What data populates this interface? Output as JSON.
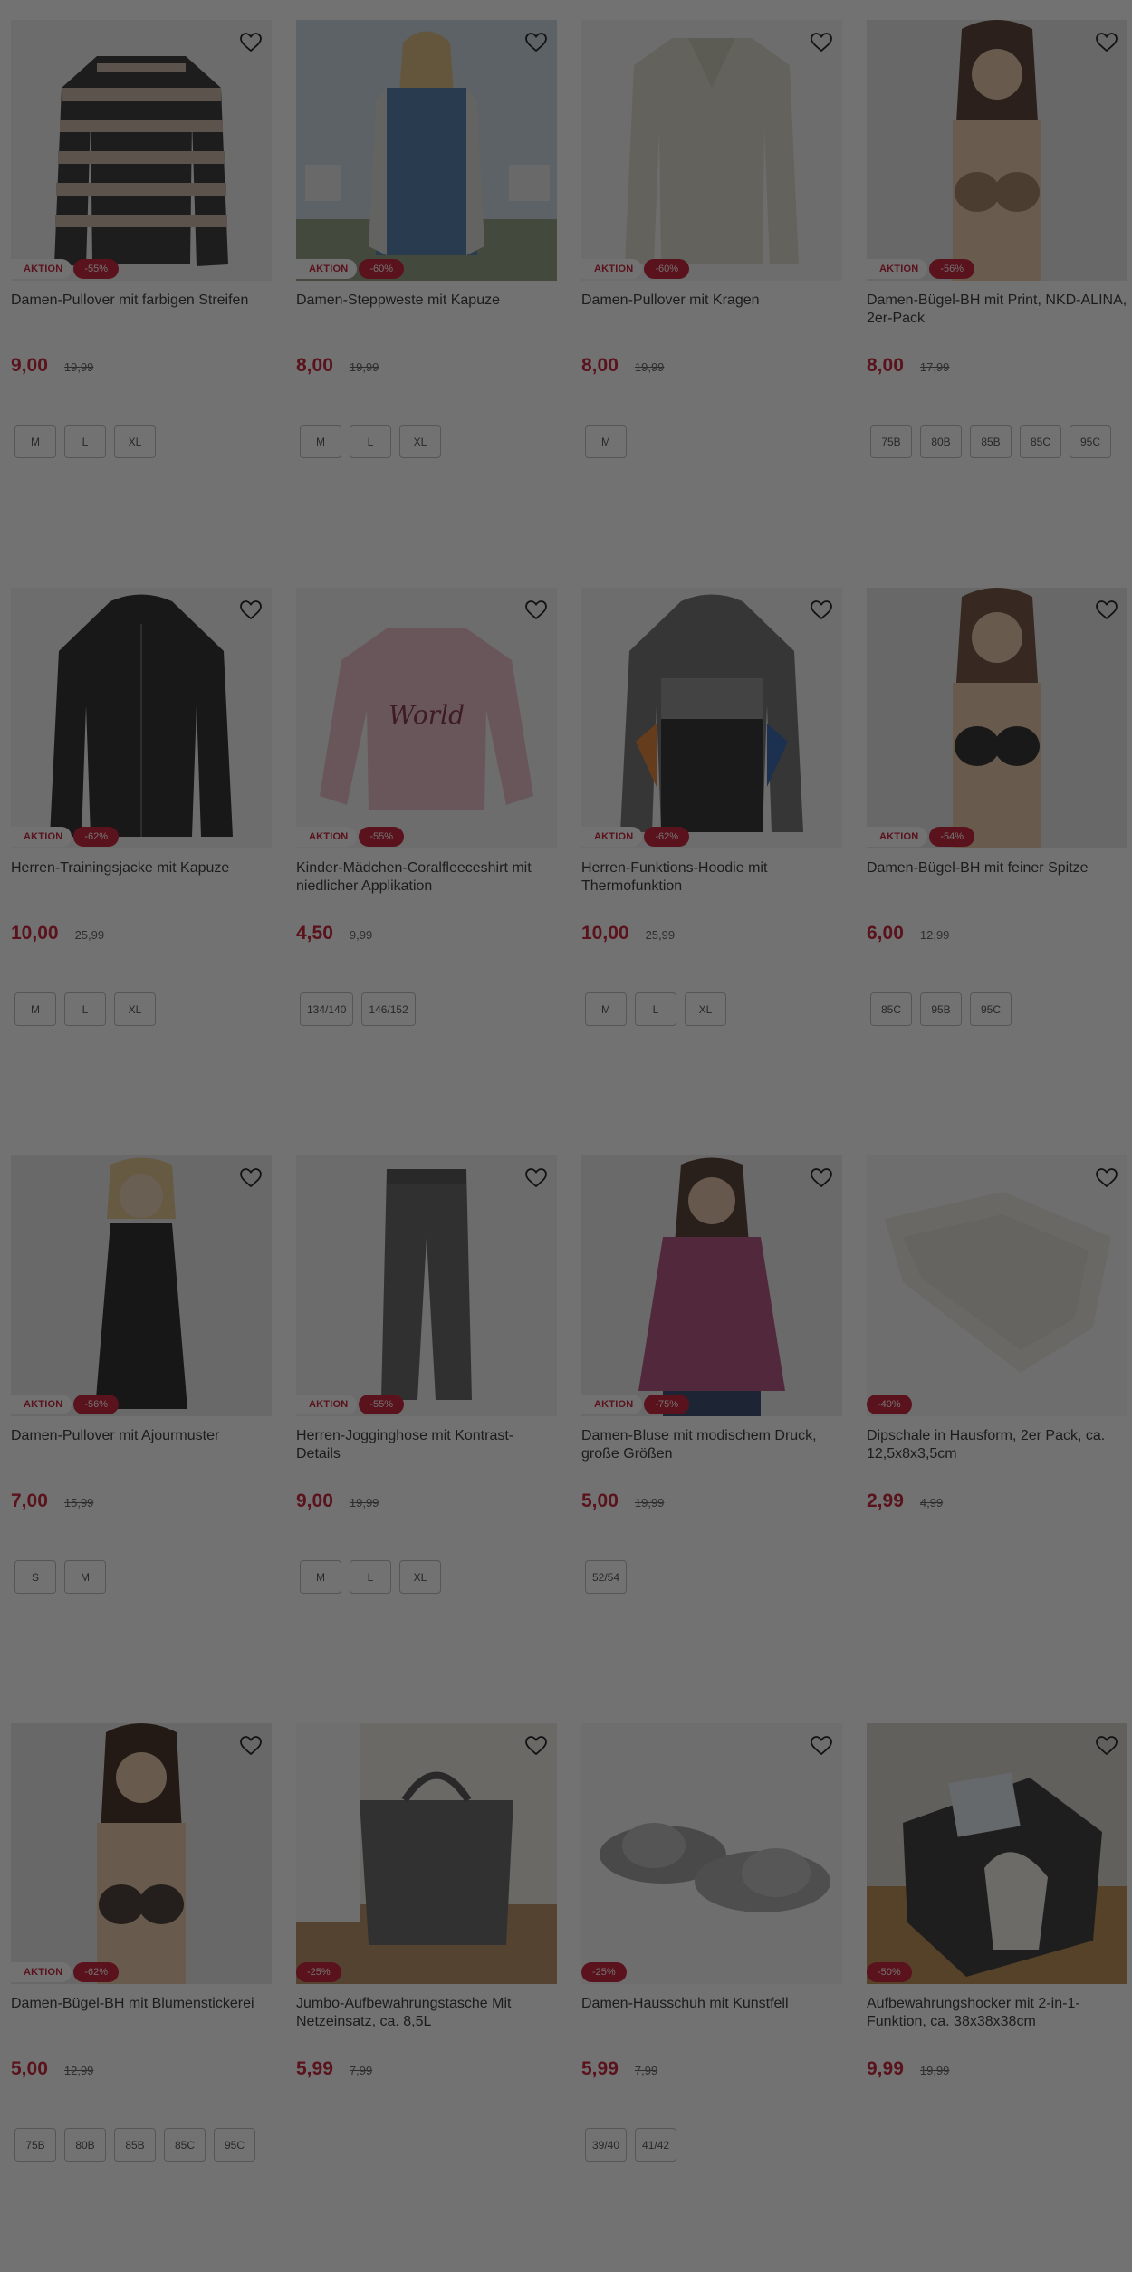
{
  "labels": {
    "aktion": "AKTION"
  },
  "colors": {
    "accent": "#c3112a",
    "overlay": "rgba(20,20,20,0.60)"
  },
  "products": [
    {
      "title": "Damen-Pullover mit farbigen Streifen",
      "price": "9,00",
      "old": "19,99",
      "aktion": true,
      "discount": "-55%",
      "sizes": [
        "M",
        "L",
        "XL"
      ],
      "image": "striped-sweater"
    },
    {
      "title": "Damen-Steppweste mit Kapuze",
      "price": "8,00",
      "old": "19,99",
      "aktion": true,
      "discount": "-60%",
      "sizes": [
        "M",
        "L",
        "XL"
      ],
      "image": "woman-blue-vest"
    },
    {
      "title": "Damen-Pullover mit Kragen",
      "price": "8,00",
      "old": "19,99",
      "aktion": true,
      "discount": "-60%",
      "sizes": [
        "M"
      ],
      "image": "beige-collar-sweater"
    },
    {
      "title": "Damen-Bügel-BH mit Print, NKD-ALINA, 2er-Pack",
      "price": "8,00",
      "old": "17,99",
      "aktion": true,
      "discount": "-56%",
      "sizes": [
        "75B",
        "80B",
        "85B",
        "85C",
        "95C"
      ],
      "image": "woman-print-bra"
    },
    {
      "title": "Herren-Trainingsjacke mit Kapuze",
      "price": "10,00",
      "old": "25,99",
      "aktion": true,
      "discount": "-62%",
      "sizes": [
        "M",
        "L",
        "XL"
      ],
      "image": "black-hooded-jacket"
    },
    {
      "title": "Kinder-Mädchen-Coralfleeceshirt mit niedlicher Applikation",
      "price": "4,50",
      "old": "9,99",
      "aktion": true,
      "discount": "-55%",
      "sizes": [
        "134/140",
        "146/152"
      ],
      "image": "pink-world-sweatshirt"
    },
    {
      "title": "Herren-Funktions-Hoodie mit Thermofunktion",
      "price": "10,00",
      "old": "25,99",
      "aktion": true,
      "discount": "-62%",
      "sizes": [
        "M",
        "L",
        "XL"
      ],
      "image": "grey-black-hoodie"
    },
    {
      "title": "Damen-Bügel-BH mit feiner Spitze",
      "price": "6,00",
      "old": "12,99",
      "aktion": true,
      "discount": "-54%",
      "sizes": [
        "85C",
        "95B",
        "95C"
      ],
      "image": "woman-black-bra"
    },
    {
      "title": "Damen-Pullover mit Ajourmuster",
      "price": "7,00",
      "old": "15,99",
      "aktion": true,
      "discount": "-56%",
      "sizes": [
        "S",
        "M"
      ],
      "image": "woman-black-turtleneck"
    },
    {
      "title": "Herren-Jogginghose mit Kontrast-Details",
      "price": "9,00",
      "old": "19,99",
      "aktion": true,
      "discount": "-55%",
      "sizes": [
        "M",
        "L",
        "XL"
      ],
      "image": "grey-jogging-pants"
    },
    {
      "title": "Damen-Bluse mit modischem Druck, große Größen",
      "price": "5,00",
      "old": "19,99",
      "aktion": true,
      "discount": "-75%",
      "sizes": [
        "52/54"
      ],
      "image": "woman-floral-blouse"
    },
    {
      "title": "Dipschale in Hausform, 2er Pack, ca. 12,5x8x3,5cm",
      "price": "2,99",
      "old": "4,99",
      "aktion": false,
      "discount": "-40%",
      "sizes": [],
      "image": "white-dip-bowl"
    },
    {
      "title": "Damen-Bügel-BH mit Blumenstickerei",
      "price": "5,00",
      "old": "12,99",
      "aktion": true,
      "discount": "-62%",
      "sizes": [
        "75B",
        "80B",
        "85B",
        "85C",
        "95C"
      ],
      "image": "woman-floral-bra"
    },
    {
      "title": "Jumbo-Aufbewahrungstasche Mit Netzeinsatz, ca. 8,5L",
      "price": "5,99",
      "old": "7,99",
      "aktion": false,
      "discount": "-25%",
      "sizes": [],
      "image": "storage-bag"
    },
    {
      "title": "Damen-Hausschuh mit Kunstfell",
      "price": "5,99",
      "old": "7,99",
      "aktion": false,
      "discount": "-25%",
      "sizes": [
        "39/40",
        "41/42"
      ],
      "image": "grey-fur-slippers"
    },
    {
      "title": "Aufbewahrungshocker mit 2-in-1-Funktion, ca. 38x38x38cm",
      "price": "9,99",
      "old": "19,99",
      "aktion": false,
      "discount": "-50%",
      "sizes": [],
      "image": "storage-stool"
    }
  ]
}
